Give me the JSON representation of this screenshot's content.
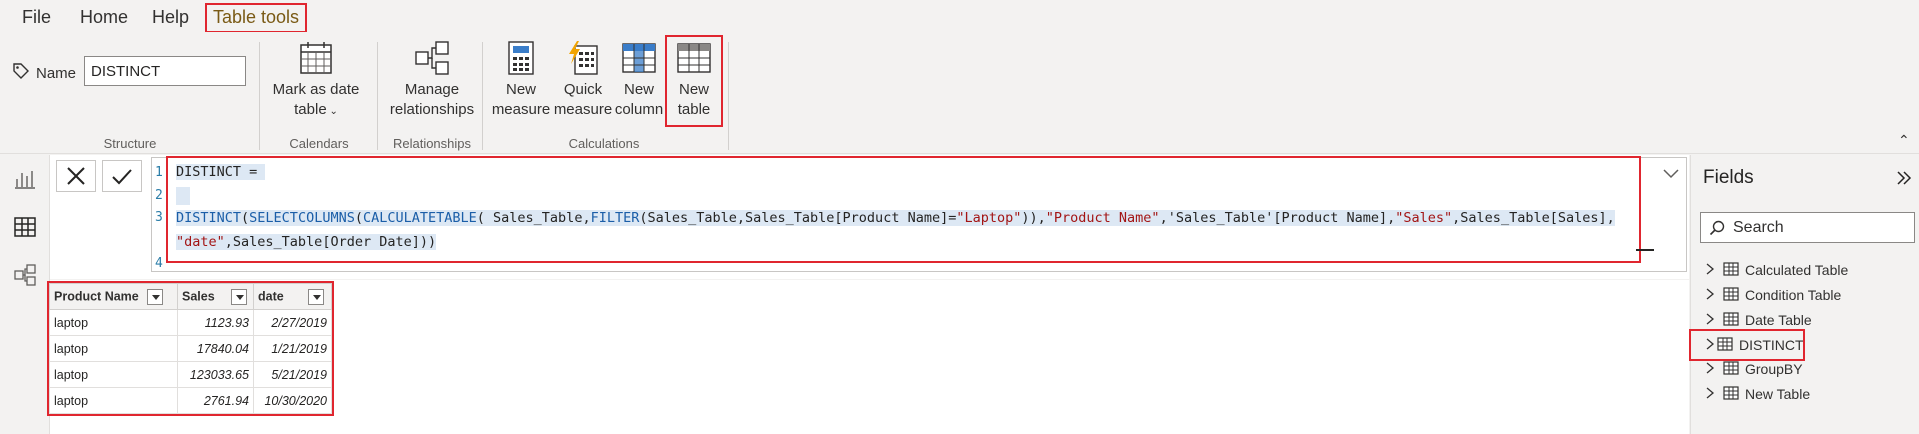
{
  "menu": {
    "file": "File",
    "home": "Home",
    "help": "Help",
    "table_tools": "Table tools"
  },
  "ribbon": {
    "name_label": "Name",
    "name_value": "DISTINCT",
    "groups": {
      "structure": "Structure",
      "calendars": "Calendars",
      "relationships": "Relationships",
      "calculations": "Calculations"
    },
    "buttons": {
      "mark_as_date_table_line1": "Mark as date",
      "mark_as_date_table_line2": "table",
      "manage_relationships_line1": "Manage",
      "manage_relationships_line2": "relationships",
      "new_measure_line1": "New",
      "new_measure_line2": "measure",
      "quick_measure_line1": "Quick",
      "quick_measure_line2": "measure",
      "new_column_line1": "New",
      "new_column_line2": "column",
      "new_table_line1": "New",
      "new_table_line2": "table"
    }
  },
  "formula": {
    "line_numbers": [
      "1",
      "2",
      "3",
      "4"
    ],
    "line1": "DISTINCT = ",
    "line3_parts": [
      {
        "t": "kw",
        "v": "DISTINCT"
      },
      {
        "t": "tbl",
        "v": "("
      },
      {
        "t": "kw",
        "v": "SELECTCOLUMNS"
      },
      {
        "t": "tbl",
        "v": "("
      },
      {
        "t": "kw",
        "v": "CALCULATETABLE"
      },
      {
        "t": "tbl",
        "v": "( Sales_Table,"
      },
      {
        "t": "kw",
        "v": "FILTER"
      },
      {
        "t": "tbl",
        "v": "(Sales_Table,Sales_Table[Product Name]="
      },
      {
        "t": "str",
        "v": "\"Laptop\""
      },
      {
        "t": "tbl",
        "v": ")),"
      },
      {
        "t": "str",
        "v": "\"Product Name\""
      },
      {
        "t": "tbl",
        "v": ",'Sales_Table'[Product Name],"
      },
      {
        "t": "str",
        "v": "\"Sales\""
      },
      {
        "t": "tbl",
        "v": ",Sales_Table[Sales],"
      }
    ],
    "line3b_parts": [
      {
        "t": "str",
        "v": "\"date\""
      },
      {
        "t": "tbl",
        "v": ",Sales_Table[Order Date]))"
      }
    ]
  },
  "table": {
    "columns": [
      "Product Name",
      "Sales",
      "date"
    ],
    "rows": [
      [
        "laptop",
        "1123.93",
        "2/27/2019"
      ],
      [
        "laptop",
        "17840.04",
        "1/21/2019"
      ],
      [
        "laptop",
        "123033.65",
        "5/21/2019"
      ],
      [
        "laptop",
        "2761.94",
        "10/30/2020"
      ]
    ]
  },
  "fields": {
    "title": "Fields",
    "search_placeholder": "Search",
    "items": [
      "Calculated Table",
      "Condition Table",
      "Date Table",
      "DISTINCT",
      "GroupBY",
      "New Table"
    ],
    "selected": "DISTINCT"
  },
  "colors": {
    "highlight": "#e0262f",
    "tab_active_text": "#7a5a15",
    "code_keyword": "#1b5ea8",
    "code_string": "#a31515"
  }
}
